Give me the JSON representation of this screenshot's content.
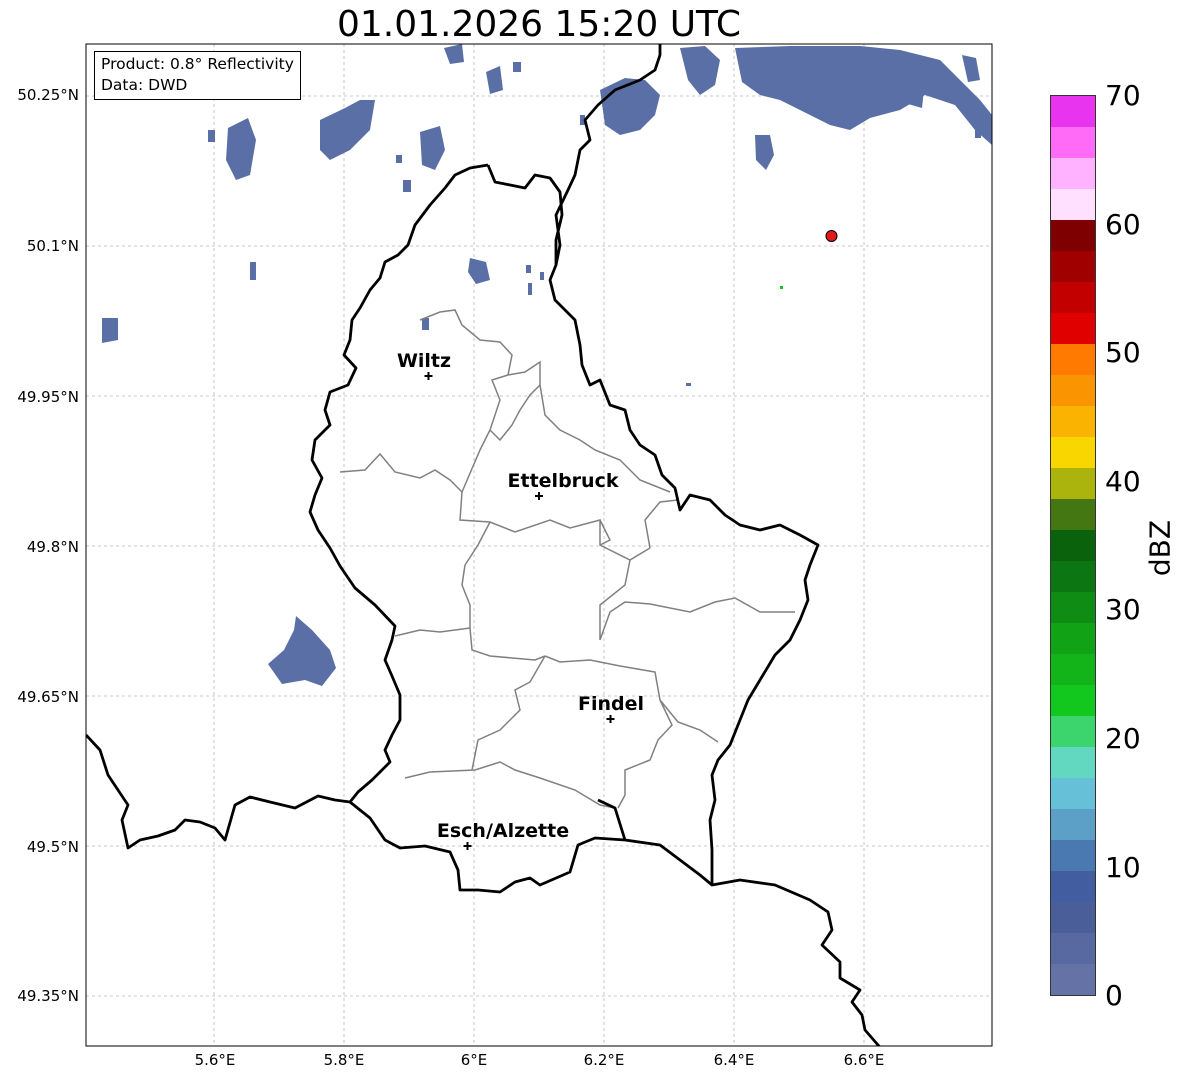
{
  "title": "01.01.2026 15:20 UTC",
  "info": {
    "product": "Product: 0.8° Reflectivity",
    "data": "Data: DWD"
  },
  "lat_labels": [
    "50.25°N",
    "50.1°N",
    "49.95°N",
    "49.8°N",
    "49.65°N",
    "49.5°N",
    "49.35°N"
  ],
  "lon_labels": [
    "5.6°E",
    "5.8°E",
    "6°E",
    "6.2°E",
    "6.4°E",
    "6.6°E"
  ],
  "cities": [
    {
      "name": "Wiltz",
      "lon": 5.93,
      "lat": 49.97
    },
    {
      "name": "Ettelbruck",
      "lon": 6.1,
      "lat": 49.85
    },
    {
      "name": "Findel",
      "lon": 6.21,
      "lat": 49.627
    },
    {
      "name": "Esch/Alzette",
      "lon": 5.99,
      "lat": 49.5
    }
  ],
  "radar_site": {
    "lon": 6.55,
    "lat": 50.11,
    "color": "#e31a1c"
  },
  "colorbar": {
    "label": "dBZ",
    "ticks": [
      "0",
      "10",
      "20",
      "30",
      "40",
      "50",
      "60",
      "70"
    ],
    "colors": [
      "#6572a6",
      "#5868a0",
      "#4a5e9a",
      "#425da0",
      "#4a78b0",
      "#5ca0c8",
      "#66c0d8",
      "#62d8c0",
      "#3cd46c",
      "#12c81e",
      "#12b41a",
      "#12a216",
      "#0e8c14",
      "#0c7612",
      "#0a620c",
      "#447612",
      "#aab40c",
      "#fad600",
      "#fab300",
      "#fa9400",
      "#ff7a00",
      "#e10000",
      "#c20000",
      "#a00000",
      "#7e0000",
      "#ffe0ff",
      "#ffb2ff",
      "#ff6af7",
      "#e934ef"
    ]
  }
}
